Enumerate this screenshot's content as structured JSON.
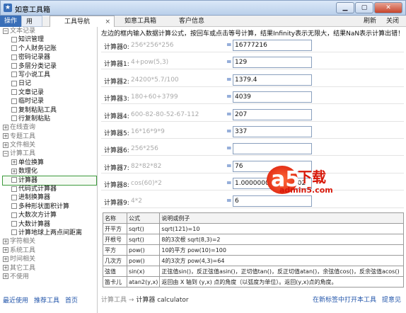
{
  "window": {
    "title": "如意工具箱",
    "app_icon": "★"
  },
  "topbar": {
    "operate": "操作",
    "user": "用户",
    "tabs": [
      {
        "label": "工具导航",
        "close": "×",
        "active": true
      },
      {
        "label": "如意工具箱",
        "active": false
      },
      {
        "label": "客户信息",
        "active": false
      }
    ],
    "refresh": "刷新",
    "close": "关闭"
  },
  "sidebar": {
    "tree": [
      {
        "kind": "group",
        "box": "−",
        "label": "文本记录"
      },
      {
        "kind": "child",
        "label": "知识管理"
      },
      {
        "kind": "child",
        "label": "个人财务记账"
      },
      {
        "kind": "child",
        "label": "密码记录器"
      },
      {
        "kind": "child",
        "label": "多层分类记录"
      },
      {
        "kind": "child",
        "label": "写小说工具"
      },
      {
        "kind": "child",
        "label": "日记"
      },
      {
        "kind": "child",
        "label": "文章记录"
      },
      {
        "kind": "child",
        "label": "临时记录"
      },
      {
        "kind": "child",
        "label": "复制粘贴工具"
      },
      {
        "kind": "child",
        "label": "行复制粘贴"
      },
      {
        "kind": "group",
        "box": "+",
        "label": "在线查询"
      },
      {
        "kind": "group",
        "box": "+",
        "label": "专题工具"
      },
      {
        "kind": "group",
        "box": "+",
        "label": "文件相关"
      },
      {
        "kind": "group",
        "box": "−",
        "label": "计算工具"
      },
      {
        "kind": "child",
        "box": "+",
        "label": "单位换算"
      },
      {
        "kind": "child",
        "box": "+",
        "label": "数理化"
      },
      {
        "kind": "child",
        "label": "计算器",
        "selected": true
      },
      {
        "kind": "child",
        "label": "代码式计算器"
      },
      {
        "kind": "child",
        "label": "进制换算器"
      },
      {
        "kind": "child",
        "label": "多种形状面积计算"
      },
      {
        "kind": "child",
        "label": "大数次方计算"
      },
      {
        "kind": "child",
        "label": "大数计算器"
      },
      {
        "kind": "child",
        "label": "计算地球上两点间距离"
      },
      {
        "kind": "group",
        "box": "+",
        "label": "字符相关"
      },
      {
        "kind": "group",
        "box": "+",
        "label": "系统工具"
      },
      {
        "kind": "group",
        "box": "+",
        "label": "时间相关"
      },
      {
        "kind": "group",
        "box": "+",
        "label": "其它工具"
      },
      {
        "kind": "group",
        "box": "+",
        "label": "不使用"
      }
    ],
    "footer": {
      "recent": "最近使用",
      "recommended": "推荐工具",
      "home": "首页"
    }
  },
  "main": {
    "notice": "左边的框内输入数据计算公式，按回车或点击等号计算，结果Infinity表示无限大，结果NaN表示计算出错！",
    "equals": "=",
    "calculators": [
      {
        "label": "计算器0:",
        "formula": "256*256*256",
        "result": "16777216"
      },
      {
        "label": "计算器1:",
        "formula": "4+pow(5,3)",
        "result": "129"
      },
      {
        "label": "计算器2:",
        "formula": "24200*5.7/100",
        "result": "1379.4"
      },
      {
        "label": "计算器3:",
        "formula": "180+60+3799",
        "result": "4039"
      },
      {
        "label": "计算器4:",
        "formula": "600-82-80-52-67-112",
        "result": "207"
      },
      {
        "label": "计算器5:",
        "formula": "16*16*9*9",
        "result": "337"
      },
      {
        "label": "计算器6:",
        "formula": "256*256",
        "result": ""
      },
      {
        "label": "计算器7:",
        "formula": "82*82*82",
        "result": "76"
      },
      {
        "label": "计算器8:",
        "formula": "cos(60)*2",
        "result": "1.0000000000000002"
      },
      {
        "label": "计算器9:",
        "formula": "4*2",
        "result": "6"
      }
    ],
    "formula_table": {
      "headers": [
        "名称",
        "公式",
        "说明或例子"
      ],
      "rows": [
        [
          "开平方",
          "sqrt()",
          "sqrt(121)=10"
        ],
        [
          "开根号",
          "sqrt()",
          "8的3次根 sqrt(8,3)=2"
        ],
        [
          "平方",
          "pow()",
          "10的平方 pow(10)=100"
        ],
        [
          "几次方",
          "pow()",
          "4的3次方 pow(4,3)=64"
        ],
        [
          "弦值",
          "sin(x)",
          "正弦值sin()，反正弦值asin()，正切值tan()，反正切值atan()，余弦值cos()，反余弦值acos()"
        ],
        [
          "笛卡儿",
          "atan2(y,x)",
          "返回由 X 轴到 (y,x) 点的角度（以弧度为单位）。返回(y,x)点的角度。"
        ]
      ]
    },
    "breadcrumb": {
      "root": "计算工具",
      "arrow": "→",
      "current": "计算器",
      "english": "calculator"
    },
    "bottom_links": {
      "open_new_tab": "在新标签中打开本工具",
      "feedback": "提意见"
    }
  },
  "watermark": {
    "badge_digit": "a5",
    "brand": "下载",
    "site": "admin5.com"
  },
  "colors": {
    "accent": "#3a6fb8",
    "equals": "#2d5fb4",
    "watermark": "#d8180a",
    "selected_outline": "#3c9a3c"
  }
}
